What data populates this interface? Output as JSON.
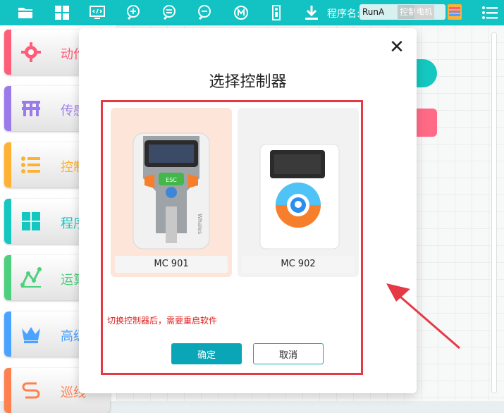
{
  "toolbar": {
    "program_name_label": "程序名:",
    "program_name_value": "RunA",
    "control_label": "控制",
    "extra_label": "电机"
  },
  "sidebar": {
    "items": [
      {
        "label": "动作",
        "icon": "gear-icon",
        "color": "#ff5e78"
      },
      {
        "label": "传感",
        "icon": "table-icon",
        "color": "#9b7bea"
      },
      {
        "label": "控制",
        "icon": "list-icon",
        "color": "#ffb133"
      },
      {
        "label": "程序",
        "icon": "grid-icon",
        "color": "#14c7c0"
      },
      {
        "label": "运算",
        "icon": "chart-icon",
        "color": "#4cd07d"
      },
      {
        "label": "高级",
        "icon": "crown-icon",
        "color": "#4aa3ff"
      },
      {
        "label": "巡线",
        "icon": "line-icon",
        "color": "#ff7f4f"
      }
    ]
  },
  "dialog": {
    "title": "选择控制器",
    "options": [
      {
        "name": "MC 901",
        "selected": true
      },
      {
        "name": "MC 902",
        "selected": false
      }
    ],
    "warning": "切换控制器后，需要重启软件",
    "confirm_label": "确定",
    "cancel_label": "取消",
    "close_icon": "close-icon"
  },
  "device_text": {
    "esc": "ESC",
    "brand": "Whales"
  },
  "colors": {
    "accent": "#13c2c2",
    "confirm": "#0aa5b7",
    "highlight": "#e63946",
    "warning": "#e02020"
  }
}
